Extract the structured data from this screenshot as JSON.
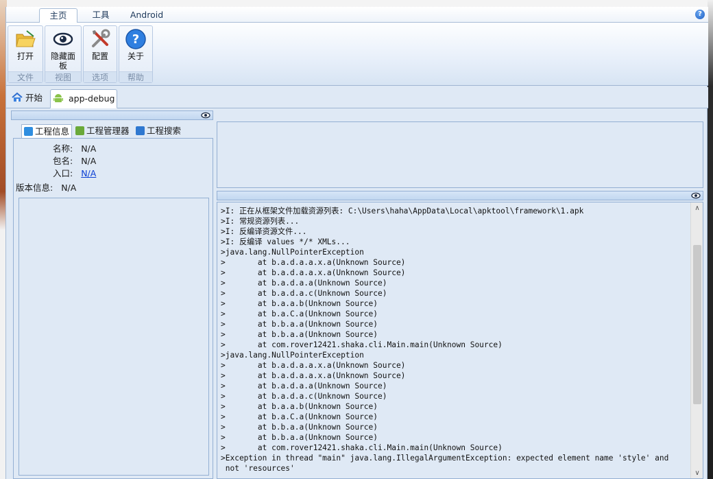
{
  "ribbon": {
    "tabs": [
      {
        "label": "主页"
      },
      {
        "label": "工具"
      },
      {
        "label": "Android"
      }
    ],
    "groups": [
      {
        "button_label": "打开",
        "group_label": "文件"
      },
      {
        "button_label": "隐藏面\n板",
        "group_label": "视图"
      },
      {
        "button_label": "配置",
        "group_label": "选项"
      },
      {
        "button_label": "关于",
        "group_label": "帮助"
      }
    ],
    "help_glyph": "?"
  },
  "doc_tabs": [
    {
      "label": "开始",
      "icon": "home-icon"
    },
    {
      "label": "app-debug",
      "icon": "android-icon"
    }
  ],
  "info_tabs": [
    {
      "label": "工程信息",
      "icon": "info-icon"
    },
    {
      "label": "工程管理器",
      "icon": "android-icon"
    },
    {
      "label": "工程搜索",
      "icon": "search-icon"
    }
  ],
  "project_info": {
    "name_label": "名称:",
    "name_value": "N/A",
    "package_label": "包名:",
    "package_value": "N/A",
    "entry_label": "入口:",
    "entry_value": "N/A",
    "version_label": "版本信息:",
    "version_value": "N/A"
  },
  "log": {
    "lines": [
      ">I: 正在从框架文件加载资源列表: C:\\Users\\haha\\AppData\\Local\\apktool\\framework\\1.apk",
      ">I: 常规资源列表...",
      ">I: 反编译资源文件...",
      ">I: 反编译 values */* XMLs...",
      ">java.lang.NullPointerException",
      ">       at b.a.d.a.a.x.a(Unknown Source)",
      ">       at b.a.d.a.a.x.a(Unknown Source)",
      ">       at b.a.d.a.a(Unknown Source)",
      ">       at b.a.d.a.c(Unknown Source)",
      ">       at b.a.a.b(Unknown Source)",
      ">       at b.a.C.a(Unknown Source)",
      ">       at b.b.a.a(Unknown Source)",
      ">       at b.b.a.a(Unknown Source)",
      ">       at com.rover12421.shaka.cli.Main.main(Unknown Source)",
      ">java.lang.NullPointerException",
      ">       at b.a.d.a.a.x.a(Unknown Source)",
      ">       at b.a.d.a.a.x.a(Unknown Source)",
      ">       at b.a.d.a.a(Unknown Source)",
      ">       at b.a.d.a.c(Unknown Source)",
      ">       at b.a.a.b(Unknown Source)",
      ">       at b.a.C.a(Unknown Source)",
      ">       at b.b.a.a(Unknown Source)",
      ">       at b.b.a.a(Unknown Source)",
      ">       at com.rover12421.shaka.cli.Main.main(Unknown Source)",
      ">Exception in thread \"main\" java.lang.IllegalArgumentException: expected element name 'style' and",
      " not 'resources'"
    ]
  },
  "colors": {
    "panel_bg": "#dfe9f5",
    "border": "#93afd3",
    "link": "#0b3fd4"
  }
}
